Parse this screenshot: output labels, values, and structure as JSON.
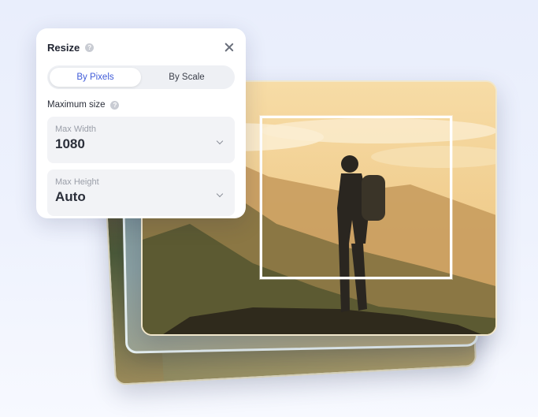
{
  "panel": {
    "title": "Resize",
    "tabs": [
      {
        "label": "By Pixels",
        "active": true
      },
      {
        "label": "By Scale",
        "active": false
      }
    ],
    "section_label": "Maximum size",
    "fields": [
      {
        "label": "Max Width",
        "value": "1080"
      },
      {
        "label": "Max Height",
        "value": "Auto"
      }
    ]
  },
  "colors": {
    "accent": "#3f5bd8",
    "panel_bg": "#ffffff",
    "field_bg": "#f2f3f6"
  }
}
